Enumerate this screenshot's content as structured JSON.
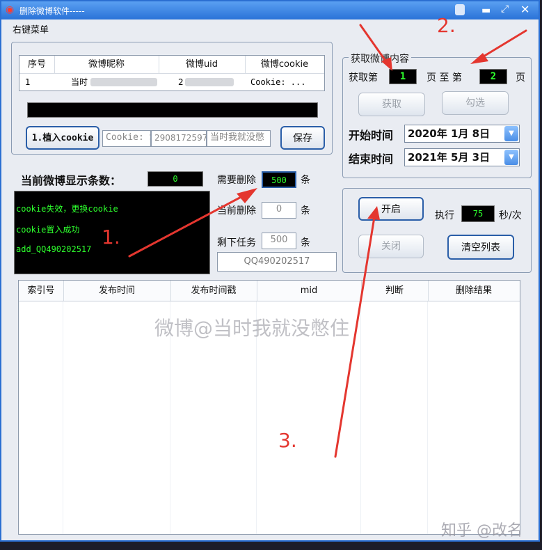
{
  "window": {
    "title": "删除微博软件-----",
    "menu": "右键菜单"
  },
  "accounts_table": {
    "columns": [
      "序号",
      "微博昵称",
      "微博uid",
      "微博cookie"
    ],
    "rows": [
      {
        "index": "1",
        "nickname": "当时",
        "uid": "2",
        "cookie": "Cookie: ..."
      }
    ]
  },
  "cookie_row": {
    "plant_button": "1.植入cookie",
    "cookie_field": "Cookie: S",
    "uid_field": "2908172597",
    "name_field": "当时我就没憋",
    "save_button": "保存"
  },
  "stats": {
    "display_count_label": "当前微博显示条数：",
    "display_count": "0",
    "need_delete_label": "需要删除",
    "need_delete": "500",
    "current_delete_label": "当前删除",
    "current_delete": "0",
    "remaining_label": "剩下任务",
    "remaining": "500",
    "unit": "条",
    "account": "QQ490202517"
  },
  "log": [
    "cookie失效，更换cookie",
    "cookie置入成功",
    "add_QQ490202517"
  ],
  "fetch": {
    "legend": "获取微博内容",
    "from_label": "获取第",
    "from_page": "1",
    "page_to_label": "页 至 第",
    "to_page": "2",
    "page_label": "页",
    "fetch_button": "获取",
    "select_button": "勾选",
    "start_label": "开始时间",
    "start_date": "2020年 1月 8日",
    "end_label": "结束时间",
    "end_date": "2021年 5月 3日"
  },
  "control": {
    "start_button": "开启",
    "execute_label": "执行",
    "interval": "75",
    "interval_unit": "秒/次",
    "stop_button": "关闭",
    "clear_button": "清空列表"
  },
  "results_table": {
    "columns": [
      "索引号",
      "发布时间",
      "发布时间戳",
      "mid",
      "判断",
      "删除结果"
    ]
  },
  "annotations": {
    "one": "1.",
    "two": "2.",
    "three": "3."
  },
  "watermarks": {
    "center": "微博@当时我就没憋住",
    "corner": "知乎 @改名"
  }
}
